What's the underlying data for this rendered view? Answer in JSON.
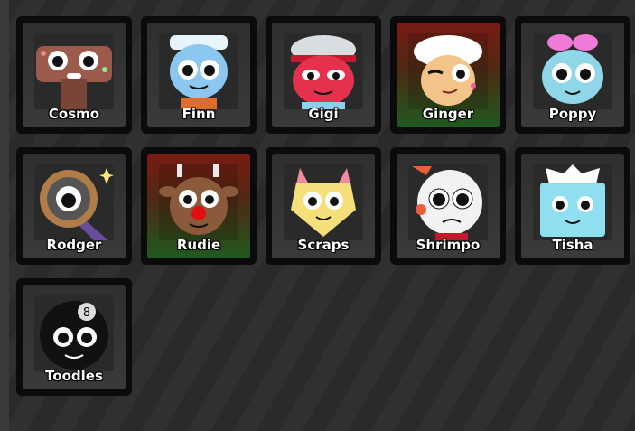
{
  "characters": [
    {
      "name": "Cosmo",
      "icon": "cosmo-icon",
      "skin": "#9b5a4c",
      "accent": "#ffffff"
    },
    {
      "name": "Finn",
      "icon": "finn-icon",
      "skin": "#8cc7f0",
      "accent": "#e06b2a"
    },
    {
      "name": "Gigi",
      "icon": "gigi-icon",
      "skin": "#e6314d",
      "accent": "#8fd0f0"
    },
    {
      "name": "Ginger",
      "icon": "ginger-icon",
      "skin": "#f2c48a",
      "accent": "#ffffff"
    },
    {
      "name": "Poppy",
      "icon": "poppy-icon",
      "skin": "#8fd7e8",
      "accent": "#f07ad7"
    },
    {
      "name": "Rodger",
      "icon": "rodger-icon",
      "skin": "#555555",
      "accent": "#b07c48"
    },
    {
      "name": "Rudie",
      "icon": "rudie-icon",
      "skin": "#8b5a3a",
      "accent": "#e01010"
    },
    {
      "name": "Scraps",
      "icon": "scraps-icon",
      "skin": "#f5df7a",
      "accent": "#f08aa0"
    },
    {
      "name": "Shrimpo",
      "icon": "shrimpo-icon",
      "skin": "#f2f2f2",
      "accent": "#e8603a"
    },
    {
      "name": "Tisha",
      "icon": "tisha-icon",
      "skin": "#8fdff0",
      "accent": "#ffffff"
    },
    {
      "name": "Toodles",
      "icon": "toodles-icon",
      "skin": "#111111",
      "accent": "#dddddd"
    }
  ]
}
